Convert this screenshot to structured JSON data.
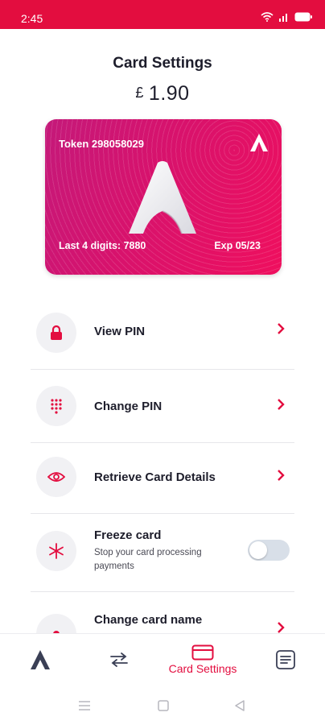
{
  "status_bar": {
    "time": "2:45",
    "icons": [
      "wifi-icon",
      "signal-icon",
      "battery-icon"
    ]
  },
  "header": {
    "title": "Card Settings"
  },
  "balance": {
    "currency": "£",
    "amount": "1.90"
  },
  "card": {
    "token": "Token 298058029",
    "last4": "Last 4 digits: 7880",
    "expiry": "Exp 05/23",
    "colors": {
      "start": "#c4197a",
      "end": "#ef0f5e"
    }
  },
  "menu": {
    "view_pin": {
      "label": "View PIN",
      "icon": "lock-icon"
    },
    "change_pin": {
      "label": "Change PIN",
      "icon": "keypad-icon"
    },
    "retrieve": {
      "label": "Retrieve Card Details",
      "icon": "eye-icon"
    },
    "freeze": {
      "label": "Freeze card",
      "subtitle": "Stop your card processing payments",
      "icon": "snowflake-icon",
      "enabled": false
    },
    "rename": {
      "label": "Change card name",
      "icon": "dot-icon"
    }
  },
  "bottom_nav": {
    "items": [
      {
        "icon": "home-logo-icon",
        "label": ""
      },
      {
        "icon": "transfer-icon",
        "label": ""
      },
      {
        "icon": "card-icon",
        "label": "Card Settings",
        "active": true
      },
      {
        "icon": "statement-icon",
        "label": ""
      }
    ]
  },
  "theme": {
    "accent": "#e30d3f",
    "text": "#1d1d2b",
    "icon_bg": "#f1f1f4",
    "nav_icon": "#3a3f55"
  }
}
